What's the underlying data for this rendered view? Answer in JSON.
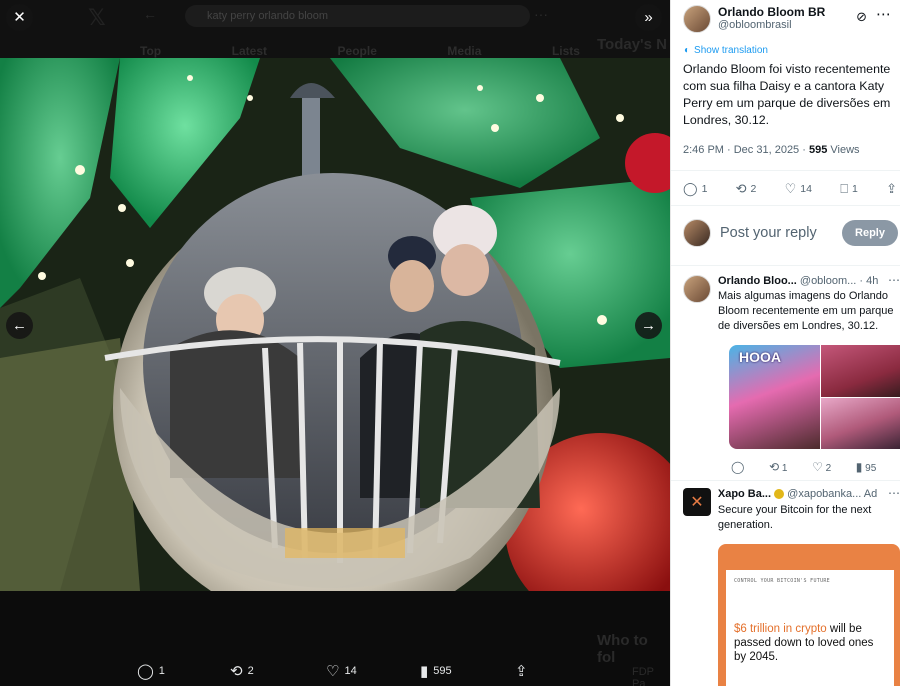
{
  "viewer": {
    "search_placeholder": "katy perry orlando bloom",
    "background_tabs": [
      "Top",
      "Latest",
      "People",
      "Media",
      "Lists"
    ],
    "background_side_heading": "Today's N",
    "background_who_to_follow": "Who to fol",
    "background_fdp": "FDP Pa",
    "media_actions": {
      "replies": "1",
      "reposts": "2",
      "likes": "14",
      "views": "595"
    }
  },
  "post": {
    "display_name": "Orlando Bloom BR",
    "handle": "@obloombrasil",
    "show_translation": "Show translation",
    "text": "Orlando Bloom foi visto recentemente com sua filha Daisy e a cantora Katy Perry em um parque de diversões em Londres, 30.12.",
    "time": "2:46 PM · Dec 31, 2025 · ",
    "views_count": "595",
    "views_label": " Views",
    "actions": {
      "replies": "1",
      "reposts": "2",
      "likes": "14",
      "bookmarks": "1"
    }
  },
  "reply_box": {
    "placeholder": "Post your reply",
    "button": "Reply"
  },
  "reply_tweet": {
    "display_name": "Orlando Bloo...",
    "handle_time": " @obloom... · 4h",
    "text": "Mais algumas imagens do Orlando Bloom recentemente em um parque de diversões em Londres, 30.12.",
    "thumb_text": "HOOA",
    "actions": {
      "replies": "",
      "reposts": "1",
      "likes": "2",
      "views": "95"
    }
  },
  "ad": {
    "display_name": "Xapo Ba...",
    "handle": " @xapobanka...",
    "ad_label": "Ad",
    "text": "Secure your Bitcoin for the next generation.",
    "card_small": "CONTROL YOUR BITCOIN'S FUTURE",
    "card_highlight": "$6 trillion in crypto",
    "card_rest": " will be passed down to loved ones by 2045."
  }
}
